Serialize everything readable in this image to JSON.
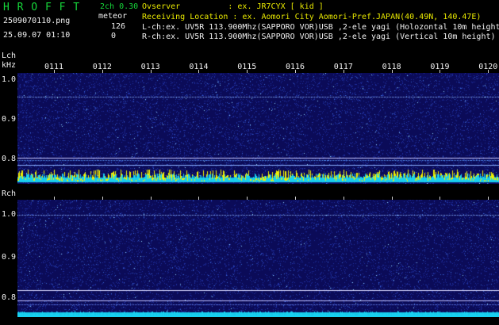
{
  "app": {
    "logo": "H R O F F T",
    "version": "2ch 0.30",
    "filename": "2509070110.png",
    "datetime": "25.09.07 01:10",
    "meteor_label": "meteor",
    "meteor_l": "126",
    "meteor_r": "0"
  },
  "station": {
    "observer": "Ovserver          : ex. JR7CYX [ kid ]",
    "location": "Receiving Location : ex. Aomori City Aomori-Pref.JAPAN(40.49N, 140.47E)",
    "lch_info": "L-ch:ex. UV5R 113.900Mhz(SAPPORO VOR)USB ,2-ele yagi (Holozontal 10m height)",
    "rch_info": "R-ch:ex. UV5R 113.900Mhz(SAPPORO VOR)USB ,2-ele yagi (Vertical 10m height)"
  },
  "lch": {
    "name": "Lch",
    "unit": "kHz",
    "ticks": [
      "1.0",
      "0.9",
      "0.8"
    ]
  },
  "rch": {
    "name": "Rch",
    "ticks": [
      "1.0",
      "0.9",
      "0.8"
    ]
  },
  "time_labels": [
    "0111",
    "0112",
    "0113",
    "0114",
    "0115",
    "0116",
    "0117",
    "0118",
    "0119",
    "0120"
  ],
  "colors": {
    "background": "#000000",
    "waterfall": "#0a0a55",
    "title_green": "#16d63a",
    "meteor_yellow": "#e8e800",
    "noise_cyan": "#20c8f0"
  }
}
